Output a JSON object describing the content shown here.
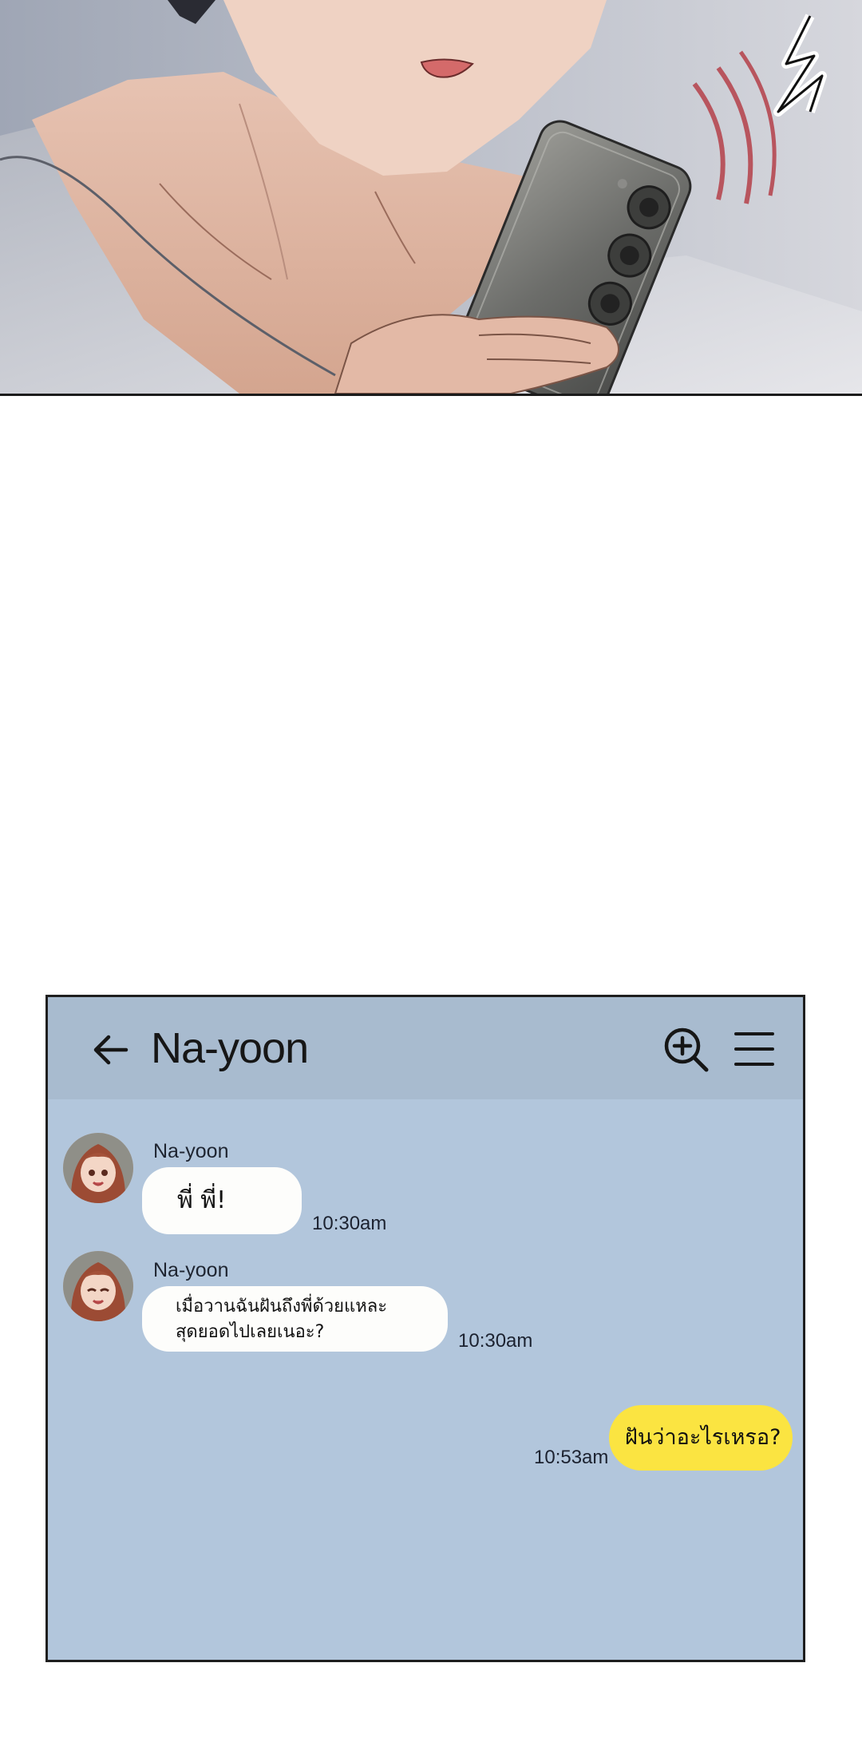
{
  "chat": {
    "contact_name": "Na-yoon",
    "messages": [
      {
        "sender": "Na-yoon",
        "text": "พี่ พี่!",
        "time": "10:30am"
      },
      {
        "sender": "Na-yoon",
        "text_line1": "เมื่อวานฉันฝันถึงพี่ด้วยแหละ",
        "text_line2": "สุดยอดไปเลยเนอะ?",
        "time": "10:30am"
      },
      {
        "sender": "me",
        "text": "ฝันว่าอะไรเหรอ?",
        "time": "10:53am"
      }
    ]
  },
  "icons": {
    "back": "arrow-left-icon",
    "search": "zoom-in-icon",
    "menu": "hamburger-menu-icon",
    "phone_sound": "vibration-lines"
  },
  "colors": {
    "chat_background": "#b2c6dc",
    "header_background": "#a8bbcf",
    "incoming_bubble": "#fdfdfb",
    "outgoing_bubble": "#fbe441"
  }
}
